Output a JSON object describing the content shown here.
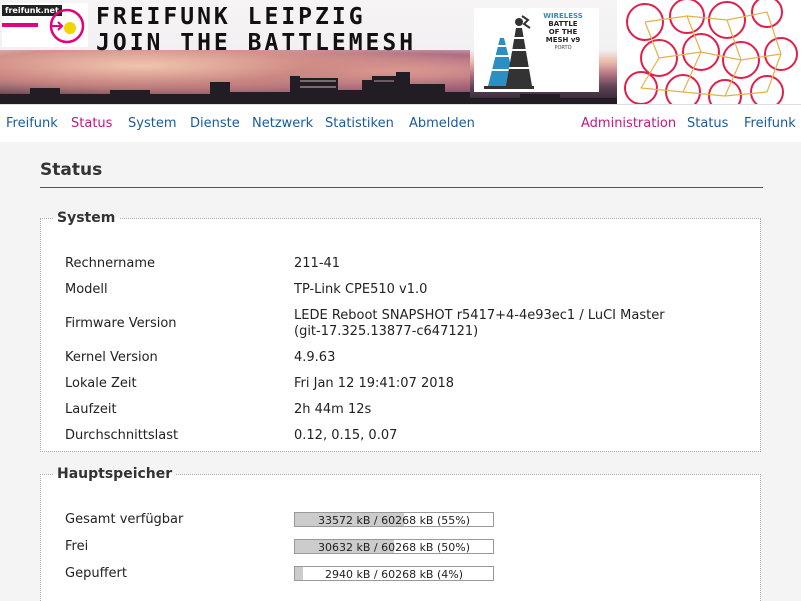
{
  "header": {
    "logo_text": "freifunk.net",
    "title_line1": "FREIFUNK LEIPZIG",
    "title_line2": "JOIN THE BATTLEMESH",
    "wbm_lines": [
      "WIRELESS",
      "BATTLE",
      "OF THE",
      "MESH v9",
      "PORTO"
    ]
  },
  "nav": {
    "left": [
      {
        "label": "Freifunk",
        "active": false
      },
      {
        "label": "Status",
        "active": true
      },
      {
        "label": "System",
        "active": false
      },
      {
        "label": "Dienste",
        "active": false
      },
      {
        "label": "Netzwerk",
        "active": false
      },
      {
        "label": "Statistiken",
        "active": false
      },
      {
        "label": "Abmelden",
        "active": false
      }
    ],
    "right": [
      {
        "label": "Administration",
        "active": true
      },
      {
        "label": "Status",
        "active": false
      },
      {
        "label": "Freifunk",
        "active": false
      }
    ]
  },
  "page": {
    "title": "Status"
  },
  "system": {
    "legend": "System",
    "rows": [
      {
        "label": "Rechnername",
        "value": "211-41"
      },
      {
        "label": "Modell",
        "value": "TP-Link CPE510 v1.0"
      },
      {
        "label": "Firmware Version",
        "value_line1": "LEDE Reboot SNAPSHOT r5417+4-4e93ec1 / LuCI Master",
        "value_line2": "(git-17.325.13877-c647121)"
      },
      {
        "label": "Kernel Version",
        "value": "4.9.63"
      },
      {
        "label": "Lokale Zeit",
        "value": "Fri Jan 12 19:41:07 2018"
      },
      {
        "label": "Laufzeit",
        "value": "2h 44m 12s"
      },
      {
        "label": "Durchschnittslast",
        "value": "0.12, 0.15, 0.07"
      }
    ]
  },
  "memory": {
    "legend": "Hauptspeicher",
    "rows": [
      {
        "label": "Gesamt verfügbar",
        "bar_text": "33572 kB / 60268 kB (55%)",
        "percent": 55
      },
      {
        "label": "Frei",
        "bar_text": "30632 kB / 60268 kB (50%)",
        "percent": 50
      },
      {
        "label": "Gepuffert",
        "bar_text": "2940 kB / 60268 kB (4%)",
        "percent": 4
      }
    ]
  },
  "colors": {
    "link": "#1a5a9c",
    "active": "#c0187e",
    "ring": "#e0204a",
    "bar_fill": "#cccccc"
  }
}
